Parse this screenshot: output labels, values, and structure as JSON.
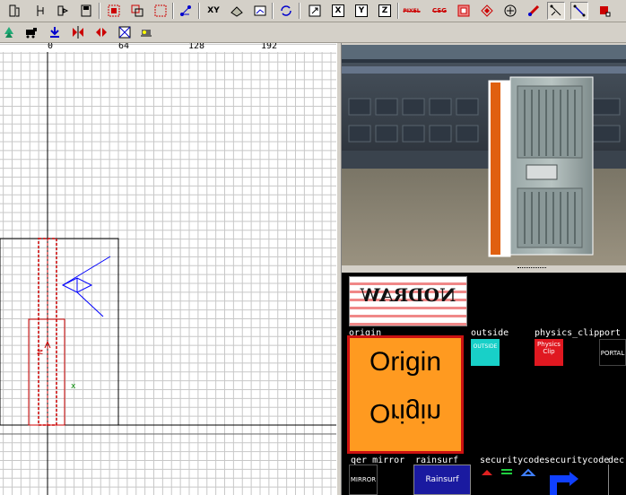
{
  "toolbar_top": {
    "buttons": [
      {
        "name": "file-open-icon"
      },
      {
        "name": "file-new-icon"
      },
      {
        "name": "export-icon"
      },
      {
        "name": "save-icon"
      },
      {
        "name": "select-box-icon"
      },
      {
        "name": "select-inside-icon"
      },
      {
        "name": "select-touching-icon"
      },
      {
        "name": "camera-icon"
      },
      {
        "name": "xy-view-label",
        "text": "XY"
      },
      {
        "name": "texture-tool-icon"
      },
      {
        "name": "viewport-icon"
      },
      {
        "name": "refresh-icon"
      },
      {
        "name": "crosshair-icon"
      },
      {
        "name": "axis-x-button",
        "text": "X"
      },
      {
        "name": "axis-y-button",
        "text": "Y"
      },
      {
        "name": "axis-z-button",
        "text": "Z"
      },
      {
        "name": "pixel-icon",
        "text": "PIXEL"
      },
      {
        "name": "csg-icon",
        "text": "CSG"
      },
      {
        "name": "hollow-icon"
      },
      {
        "name": "clipper-icon"
      },
      {
        "name": "patch-icon"
      },
      {
        "name": "patch-bend-icon"
      },
      {
        "name": "vertex-edit-icon"
      },
      {
        "name": "edge-edit-icon"
      },
      {
        "name": "brush-icon"
      }
    ]
  },
  "toolbar_second": {
    "buttons": [
      {
        "name": "entity-tree-icon"
      },
      {
        "name": "train-icon"
      },
      {
        "name": "drop-icon"
      },
      {
        "name": "flip-x-icon"
      },
      {
        "name": "flip-y-icon"
      },
      {
        "name": "texture-lock-icon"
      },
      {
        "name": "camera-mode-icon"
      }
    ]
  },
  "grid_view": {
    "coord_labels": [
      "0",
      "64",
      "128",
      "192"
    ],
    "entity_labels": [
      "N"
    ],
    "origin_marker": "x"
  },
  "texture_browser": {
    "items": [
      {
        "name": "nodraw",
        "label": "",
        "text": "NODRAW"
      },
      {
        "name": "origin",
        "label": "origin",
        "text": "Origin",
        "selected": true
      },
      {
        "name": "outside",
        "label": "outside",
        "text": "OUTSIDE"
      },
      {
        "name": "physics-clip",
        "label": "physics_clip",
        "text": "Physics Clip"
      },
      {
        "name": "portal",
        "label": "port",
        "text": "PORTAL"
      },
      {
        "name": "qer-mirror",
        "label": "qer_mirror",
        "text": "MIRROR"
      },
      {
        "name": "rainsurf",
        "label": "rainsurf",
        "text": "Rainsurf"
      },
      {
        "name": "securitycode1",
        "label": "securitycode"
      },
      {
        "name": "securitycode2",
        "label": "securitycode"
      },
      {
        "name": "partial",
        "label": "dec"
      }
    ]
  },
  "colors": {
    "grid": "#c8c8c8",
    "grid_major": "#000000",
    "brush_red": "#cc0000",
    "entity_blue": "#0000ff",
    "selection": "#cc1111",
    "origin_orange": "#ff9a20"
  }
}
